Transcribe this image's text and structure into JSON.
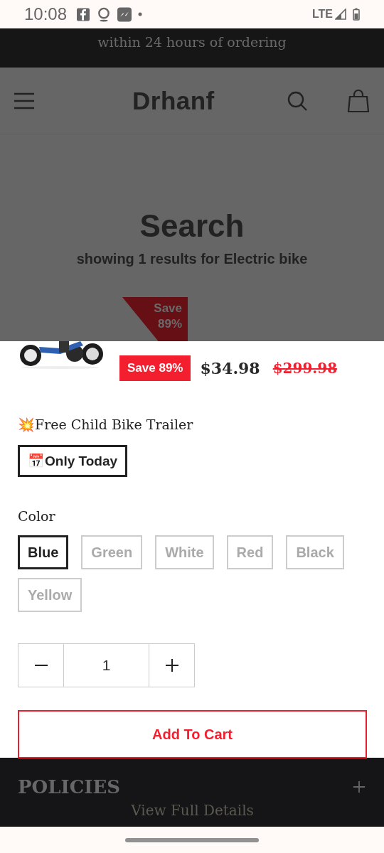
{
  "status_bar": {
    "time": "10:08",
    "network": "LTE"
  },
  "announcement": {
    "text": "within 24 hours of ordering"
  },
  "header": {
    "logo": "Drhanf"
  },
  "search": {
    "title": "Search",
    "summary": "showing 1 results for Electric bike"
  },
  "product": {
    "ribbon": "Save 89%",
    "badge": "Save 89%",
    "price": "$34.98",
    "compare_price": "$299.98",
    "promo": "💥Free Child Bike Trailer",
    "tag": "📅Only Today",
    "option_label": "Color",
    "options": [
      {
        "label": "Blue",
        "selected": true
      },
      {
        "label": "Green",
        "selected": false
      },
      {
        "label": "White",
        "selected": false
      },
      {
        "label": "Red",
        "selected": false
      },
      {
        "label": "Black",
        "selected": false
      },
      {
        "label": "Yellow",
        "selected": false
      }
    ],
    "quantity": "1",
    "add_to_cart": "Add To Cart"
  },
  "footer": {
    "heading": "POLICIES",
    "link": "View Full Details"
  }
}
